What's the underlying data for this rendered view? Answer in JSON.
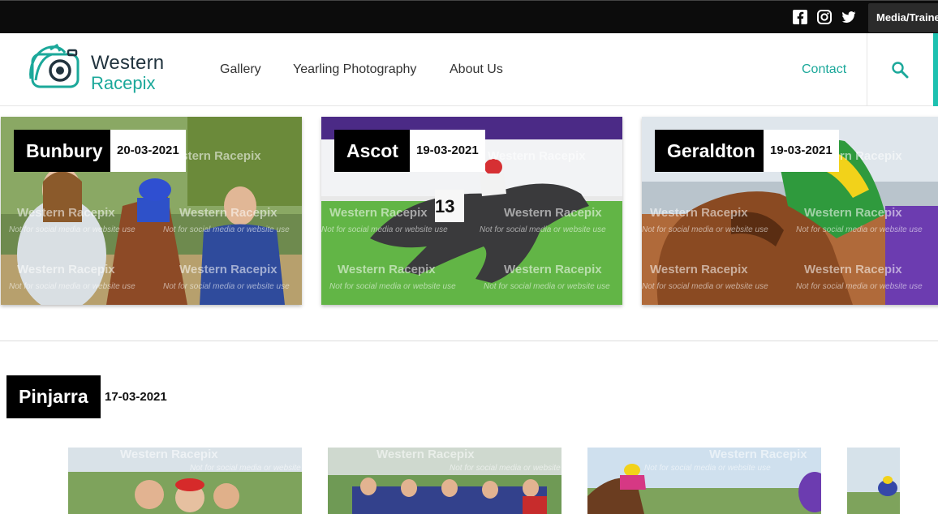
{
  "topbar": {
    "social": [
      {
        "name": "facebook-icon"
      },
      {
        "name": "instagram-icon"
      },
      {
        "name": "twitter-icon"
      }
    ],
    "media_button": "Media/Trainer"
  },
  "header": {
    "logo": {
      "line1": "Western",
      "line2": "Racepix"
    },
    "nav": [
      "Gallery",
      "Yearling Photography",
      "About Us"
    ],
    "contact": "Contact",
    "search_icon": "search-icon",
    "accent": "#1ec1b0",
    "brand_dark": "#22343f",
    "brand_teal": "#1ba89a"
  },
  "cards": [
    {
      "venue": "Bunbury",
      "date": "20-03-2021"
    },
    {
      "venue": "Ascot",
      "date": "19-03-2021"
    },
    {
      "venue": "Geraldton",
      "date": "19-03-2021"
    }
  ],
  "watermark": {
    "brand": "Western Racepix",
    "note": "Not for social media or website use"
  },
  "section": {
    "venue": "Pinjarra",
    "date": "17-03-2021"
  }
}
